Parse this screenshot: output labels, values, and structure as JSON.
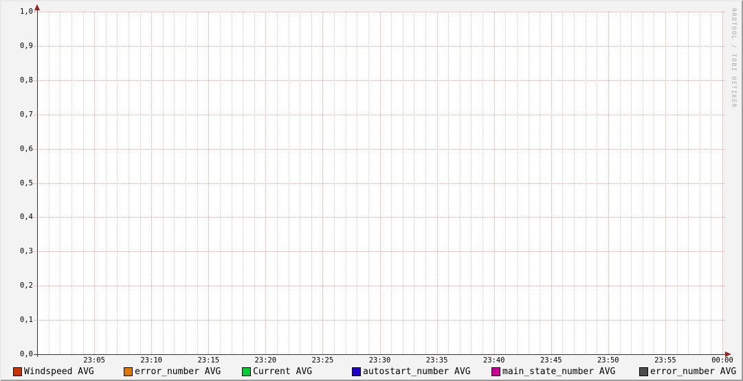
{
  "watermark": "RRDTOOL / TOBI OETIKER",
  "colors": {
    "background": "#f3f3f3",
    "canvas": "#ffffff",
    "major_grid": "#e89a9a",
    "minor_grid": "#c9c9c9",
    "axis": "#333333",
    "arrow": "#992222",
    "text": "#000000",
    "watermark": "#a8a8a8"
  },
  "chart_data": {
    "type": "line",
    "title": "",
    "xlabel": "",
    "ylabel": "",
    "x_axis": {
      "start": "23:00",
      "end": "00:00",
      "major_tick_interval_minutes": 5,
      "minor_tick_interval_minutes": 1,
      "tick_labels": [
        "23:05",
        "23:10",
        "23:15",
        "23:20",
        "23:25",
        "23:30",
        "23:35",
        "23:40",
        "23:45",
        "23:50",
        "23:55",
        "00:00"
      ]
    },
    "y_axis": {
      "min": 0.0,
      "max": 1.0,
      "major_step": 0.1,
      "tick_labels": [
        "0,0",
        "0,1",
        "0,2",
        "0,3",
        "0,4",
        "0,5",
        "0,6",
        "0,7",
        "0,8",
        "0,9",
        "1,0"
      ]
    },
    "grid": true,
    "legend_position": "bottom",
    "series": [
      {
        "name": "Windspeed",
        "label": "Windspeed AVG",
        "color": "#cc3300",
        "values": []
      },
      {
        "name": "error_number",
        "label": "error_number AVG",
        "color": "#dd7700",
        "values": []
      },
      {
        "name": "Current",
        "label": "Current AVG",
        "color": "#00cc33",
        "values": []
      },
      {
        "name": "autostart_number",
        "label": "autostart_number AVG",
        "color": "#2200cc",
        "values": []
      },
      {
        "name": "main_state_number",
        "label": "main_state_number AVG",
        "color": "#cc0099",
        "values": []
      },
      {
        "name": "error_number_2",
        "label": "error_number AVG",
        "color": "#4d4d4d",
        "values": []
      }
    ]
  }
}
